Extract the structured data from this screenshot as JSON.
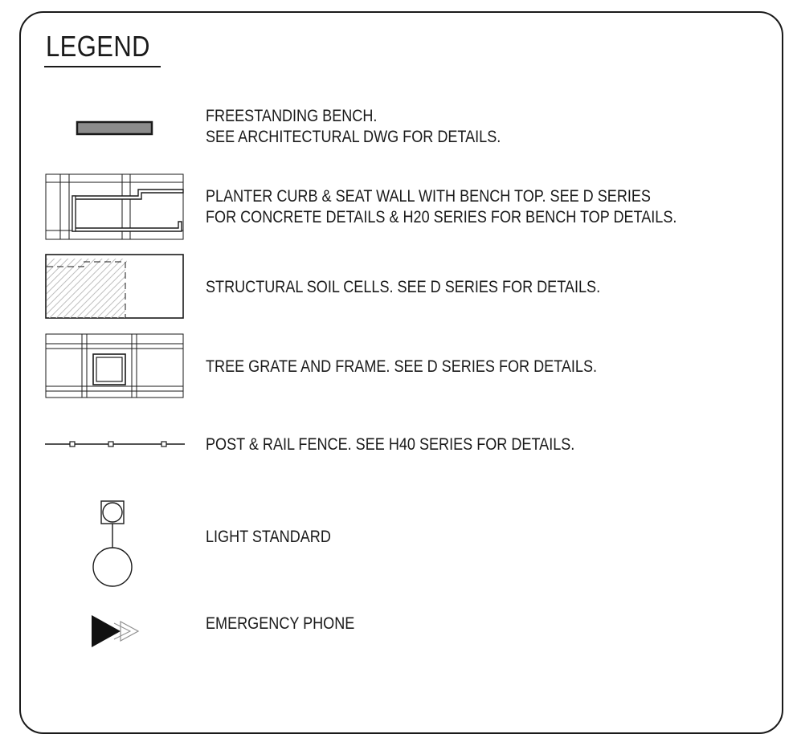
{
  "legend": {
    "title": "LEGEND",
    "items": [
      {
        "symbol": "bench-symbol-icon",
        "lines": [
          "FREESTANDING BENCH.",
          "SEE ARCHITECTURAL DWG FOR DETAILS."
        ]
      },
      {
        "symbol": "planter-curb-icon",
        "lines": [
          "PLANTER CURB & SEAT WALL WITH BENCH TOP. SEE D SERIES",
          "FOR CONCRETE DETAILS & H20 SERIES FOR BENCH TOP DETAILS."
        ]
      },
      {
        "symbol": "soil-cells-icon",
        "lines": [
          "STRUCTURAL SOIL CELLS. SEE D SERIES FOR DETAILS."
        ]
      },
      {
        "symbol": "tree-grate-icon",
        "lines": [
          "TREE GRATE AND FRAME. SEE D SERIES FOR DETAILS."
        ]
      },
      {
        "symbol": "fence-icon",
        "lines": [
          "POST & RAIL FENCE. SEE H40 SERIES FOR DETAILS."
        ]
      },
      {
        "symbol": "light-standard-icon",
        "lines": [
          "LIGHT STANDARD"
        ]
      },
      {
        "symbol": "emergency-phone-icon",
        "lines": [
          "EMERGENCY PHONE"
        ]
      }
    ]
  },
  "colors": {
    "ink": "#1a1a1a",
    "bench_fill": "#8c8c8c",
    "hatch": "#bdbdbd"
  }
}
